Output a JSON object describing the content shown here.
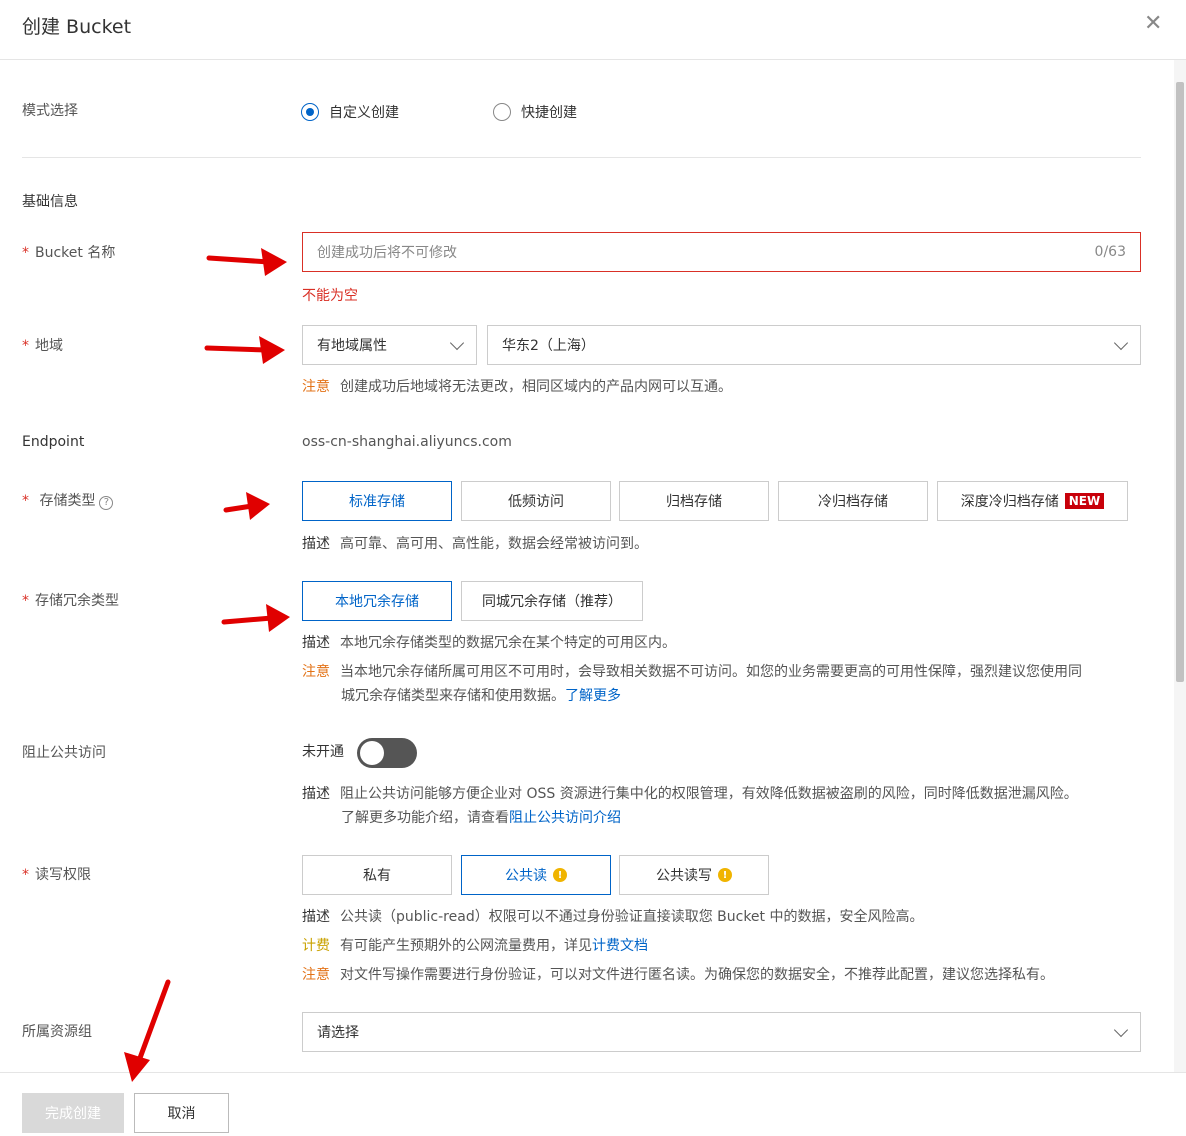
{
  "header": {
    "title": "创建 Bucket",
    "close": "✕"
  },
  "mode": {
    "label": "模式选择",
    "options": [
      "自定义创建",
      "快捷创建"
    ],
    "selected": 0
  },
  "basic_info": {
    "heading": "基础信息"
  },
  "bucket_name": {
    "label": "Bucket 名称",
    "placeholder": "创建成功后将不可修改",
    "counter": "0/63",
    "error": "不能为空"
  },
  "region": {
    "label": "地域",
    "attribute_select": "有地域属性",
    "region_select": "华东2（上海）",
    "note_key": "注意",
    "note_text": "创建成功后地域将无法更改，相同区域内的产品内网可以互通。"
  },
  "endpoint": {
    "label": "Endpoint",
    "value": "oss-cn-shanghai.aliyuncs.com"
  },
  "storage_class": {
    "label": "存储类型",
    "help_icon": "?",
    "options": [
      "标准存储",
      "低频访问",
      "归档存储",
      "冷归档存储",
      "深度冷归档存储"
    ],
    "new_badge": "NEW",
    "selected": 0,
    "desc_key": "描述",
    "desc_text": "高可靠、高可用、高性能，数据会经常被访问到。"
  },
  "redundancy": {
    "label": "存储冗余类型",
    "options": [
      "本地冗余存储",
      "同城冗余存储（推荐）"
    ],
    "selected": 0,
    "desc_key": "描述",
    "desc_text": "本地冗余存储类型的数据冗余在某个特定的可用区内。",
    "note_key": "注意",
    "note_line1": "当本地冗余存储所属可用区不可用时，会导致相关数据不可访问。如您的业务需要更高的可用性保障，强烈建议您使用同",
    "note_line2": "城冗余存储类型来存储和使用数据。",
    "note_link": "了解更多"
  },
  "block_public": {
    "label": "阻止公共访问",
    "status": "未开通",
    "enabled": false,
    "desc_key": "描述",
    "desc_line1": "阻止公共访问能够方便企业对 OSS 资源进行集中化的权限管理，有效降低数据被盗刷的风险，同时降低数据泄漏风险。",
    "desc_line2": "了解更多功能介绍，请查看",
    "desc_link": "阻止公共访问介绍"
  },
  "acl": {
    "label": "读写权限",
    "options": [
      "私有",
      "公共读",
      "公共读写"
    ],
    "selected": 1,
    "warn_icon": "!",
    "desc_key": "描述",
    "desc_text": "公共读（public-read）权限可以不通过身份验证直接读取您 Bucket 中的数据，安全风险高。",
    "fee_key": "计费",
    "fee_text": "有可能产生预期外的公网流量费用，详见",
    "fee_link": "计费文档",
    "note_key": "注意",
    "note_text": "对文件写操作需要进行身份验证，可以对文件进行匿名读。为确保您的数据安全，不推荐此配置，建议您选择私有。"
  },
  "resource_group": {
    "label": "所属资源组",
    "placeholder": "请选择"
  },
  "footer": {
    "submit": "完成创建",
    "cancel": "取消"
  },
  "colors": {
    "accent": "#0064c8",
    "error": "#d93026",
    "warning": "#e37318",
    "annotation": "#e00000"
  }
}
